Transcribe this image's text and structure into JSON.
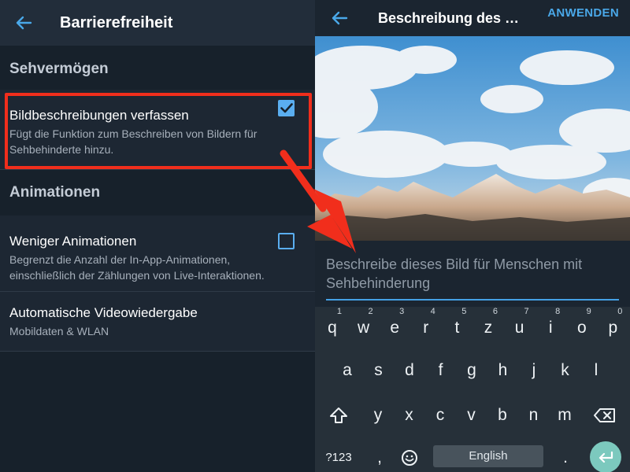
{
  "left": {
    "header": {
      "title": "Barrierefreiheit"
    },
    "section_vision": "Sehvermögen",
    "item_image_desc": {
      "title": "Bildbeschreibungen verfassen",
      "subtitle_line1": "Fügt die Funktion zum Beschreiben von Bildern für",
      "subtitle_line2": "Sehbehinderte hinzu.",
      "checked": true
    },
    "section_animations": "Animationen",
    "item_fewer_anim": {
      "title": "Weniger Animationen",
      "subtitle_line1": "Begrenzt die Anzahl der In-App-Animationen,",
      "subtitle_line2": "einschließlich der Zählungen von Live-Interaktionen.",
      "checked": false
    },
    "item_autoplay": {
      "title": "Automatische Videowiedergabe",
      "subtitle": "Mobildaten & WLAN"
    }
  },
  "right": {
    "header": {
      "title": "Beschreibung des …",
      "apply_label": "ANWENDEN"
    },
    "description_placeholder_line1": "Beschreibe dieses Bild für Menschen mit",
    "description_placeholder_line2": "Sehbehinderung"
  },
  "keyboard": {
    "row1": [
      {
        "k": "q",
        "n": "1"
      },
      {
        "k": "w",
        "n": "2"
      },
      {
        "k": "e",
        "n": "3"
      },
      {
        "k": "r",
        "n": "4"
      },
      {
        "k": "t",
        "n": "5"
      },
      {
        "k": "z",
        "n": "6"
      },
      {
        "k": "u",
        "n": "7"
      },
      {
        "k": "i",
        "n": "8"
      },
      {
        "k": "o",
        "n": "9"
      },
      {
        "k": "p",
        "n": "0"
      }
    ],
    "row2": [
      "a",
      "s",
      "d",
      "f",
      "g",
      "h",
      "j",
      "k",
      "l"
    ],
    "row3": [
      "y",
      "x",
      "c",
      "v",
      "b",
      "n",
      "m"
    ],
    "symbols_label": "?123",
    "comma": ",",
    "space_label": "English",
    "period": "."
  },
  "colors": {
    "accent_blue": "#4aa8e8",
    "highlight_red": "#f12e1c",
    "enter_teal": "#7cc9be"
  }
}
